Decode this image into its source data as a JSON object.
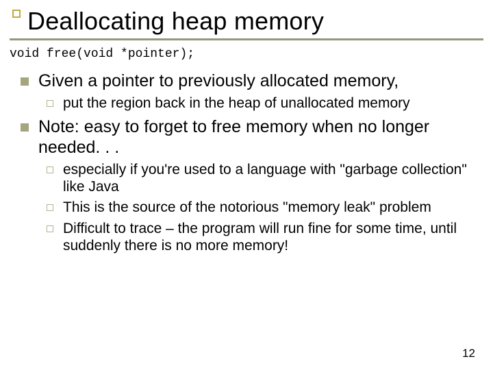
{
  "title": "Deallocating heap memory",
  "code": "void free(void *pointer);",
  "bullets": [
    {
      "text": "Given a pointer to previously allocated memory,",
      "sub": [
        "put the region back in the heap of unallocated memory"
      ]
    },
    {
      "text": "Note: easy to forget to free memory when no longer needed. . .",
      "sub": [
        "especially if you're used to a language with \"garbage collection\" like Java",
        "This is the source of the notorious \"memory leak\" problem",
        "Difficult to trace – the program will run fine for some time, until suddenly there is no more memory!"
      ]
    }
  ],
  "page_number": "12"
}
